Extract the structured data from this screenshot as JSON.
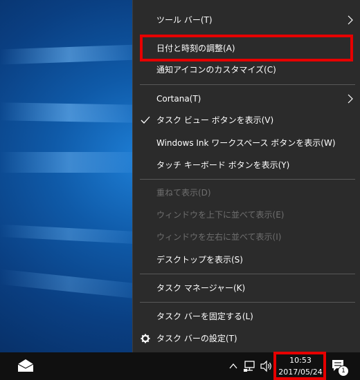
{
  "menu": {
    "items": [
      {
        "label": "ツール バー(T)",
        "submenu": true,
        "enabled": true
      },
      {
        "label": "日付と時刻の調整(A)",
        "enabled": true,
        "highlighted": true
      },
      {
        "label": "通知アイコンのカスタマイズ(C)",
        "enabled": true
      },
      {
        "label": "Cortana(T)",
        "submenu": true,
        "enabled": true
      },
      {
        "label": "タスク ビュー ボタンを表示(V)",
        "checked": true,
        "enabled": true
      },
      {
        "label": "Windows Ink ワークスペース ボタンを表示(W)",
        "enabled": true
      },
      {
        "label": "タッチ キーボード ボタンを表示(Y)",
        "enabled": true
      },
      {
        "label": "重ねて表示(D)",
        "enabled": false
      },
      {
        "label": "ウィンドウを上下に並べて表示(E)",
        "enabled": false
      },
      {
        "label": "ウィンドウを左右に並べて表示(I)",
        "enabled": false
      },
      {
        "label": "デスクトップを表示(S)",
        "enabled": true
      },
      {
        "label": "タスク マネージャー(K)",
        "enabled": true
      },
      {
        "label": "タスク バーを固定する(L)",
        "enabled": true
      },
      {
        "label": "タスク バーの設定(T)",
        "icon": "gear-icon",
        "enabled": true
      }
    ]
  },
  "taskbar": {
    "clock_time": "10:53",
    "clock_date": "2017/05/24",
    "notification_count": "1",
    "icons": [
      "mail-icon",
      "chevron-up-icon",
      "network-icon",
      "volume-icon",
      "action-center-icon"
    ]
  },
  "colors": {
    "menu_bg": "#2b2b2b",
    "taskbar_bg": "#101010",
    "highlight_box": "#e60000",
    "disabled_text": "#6f6f6f"
  }
}
